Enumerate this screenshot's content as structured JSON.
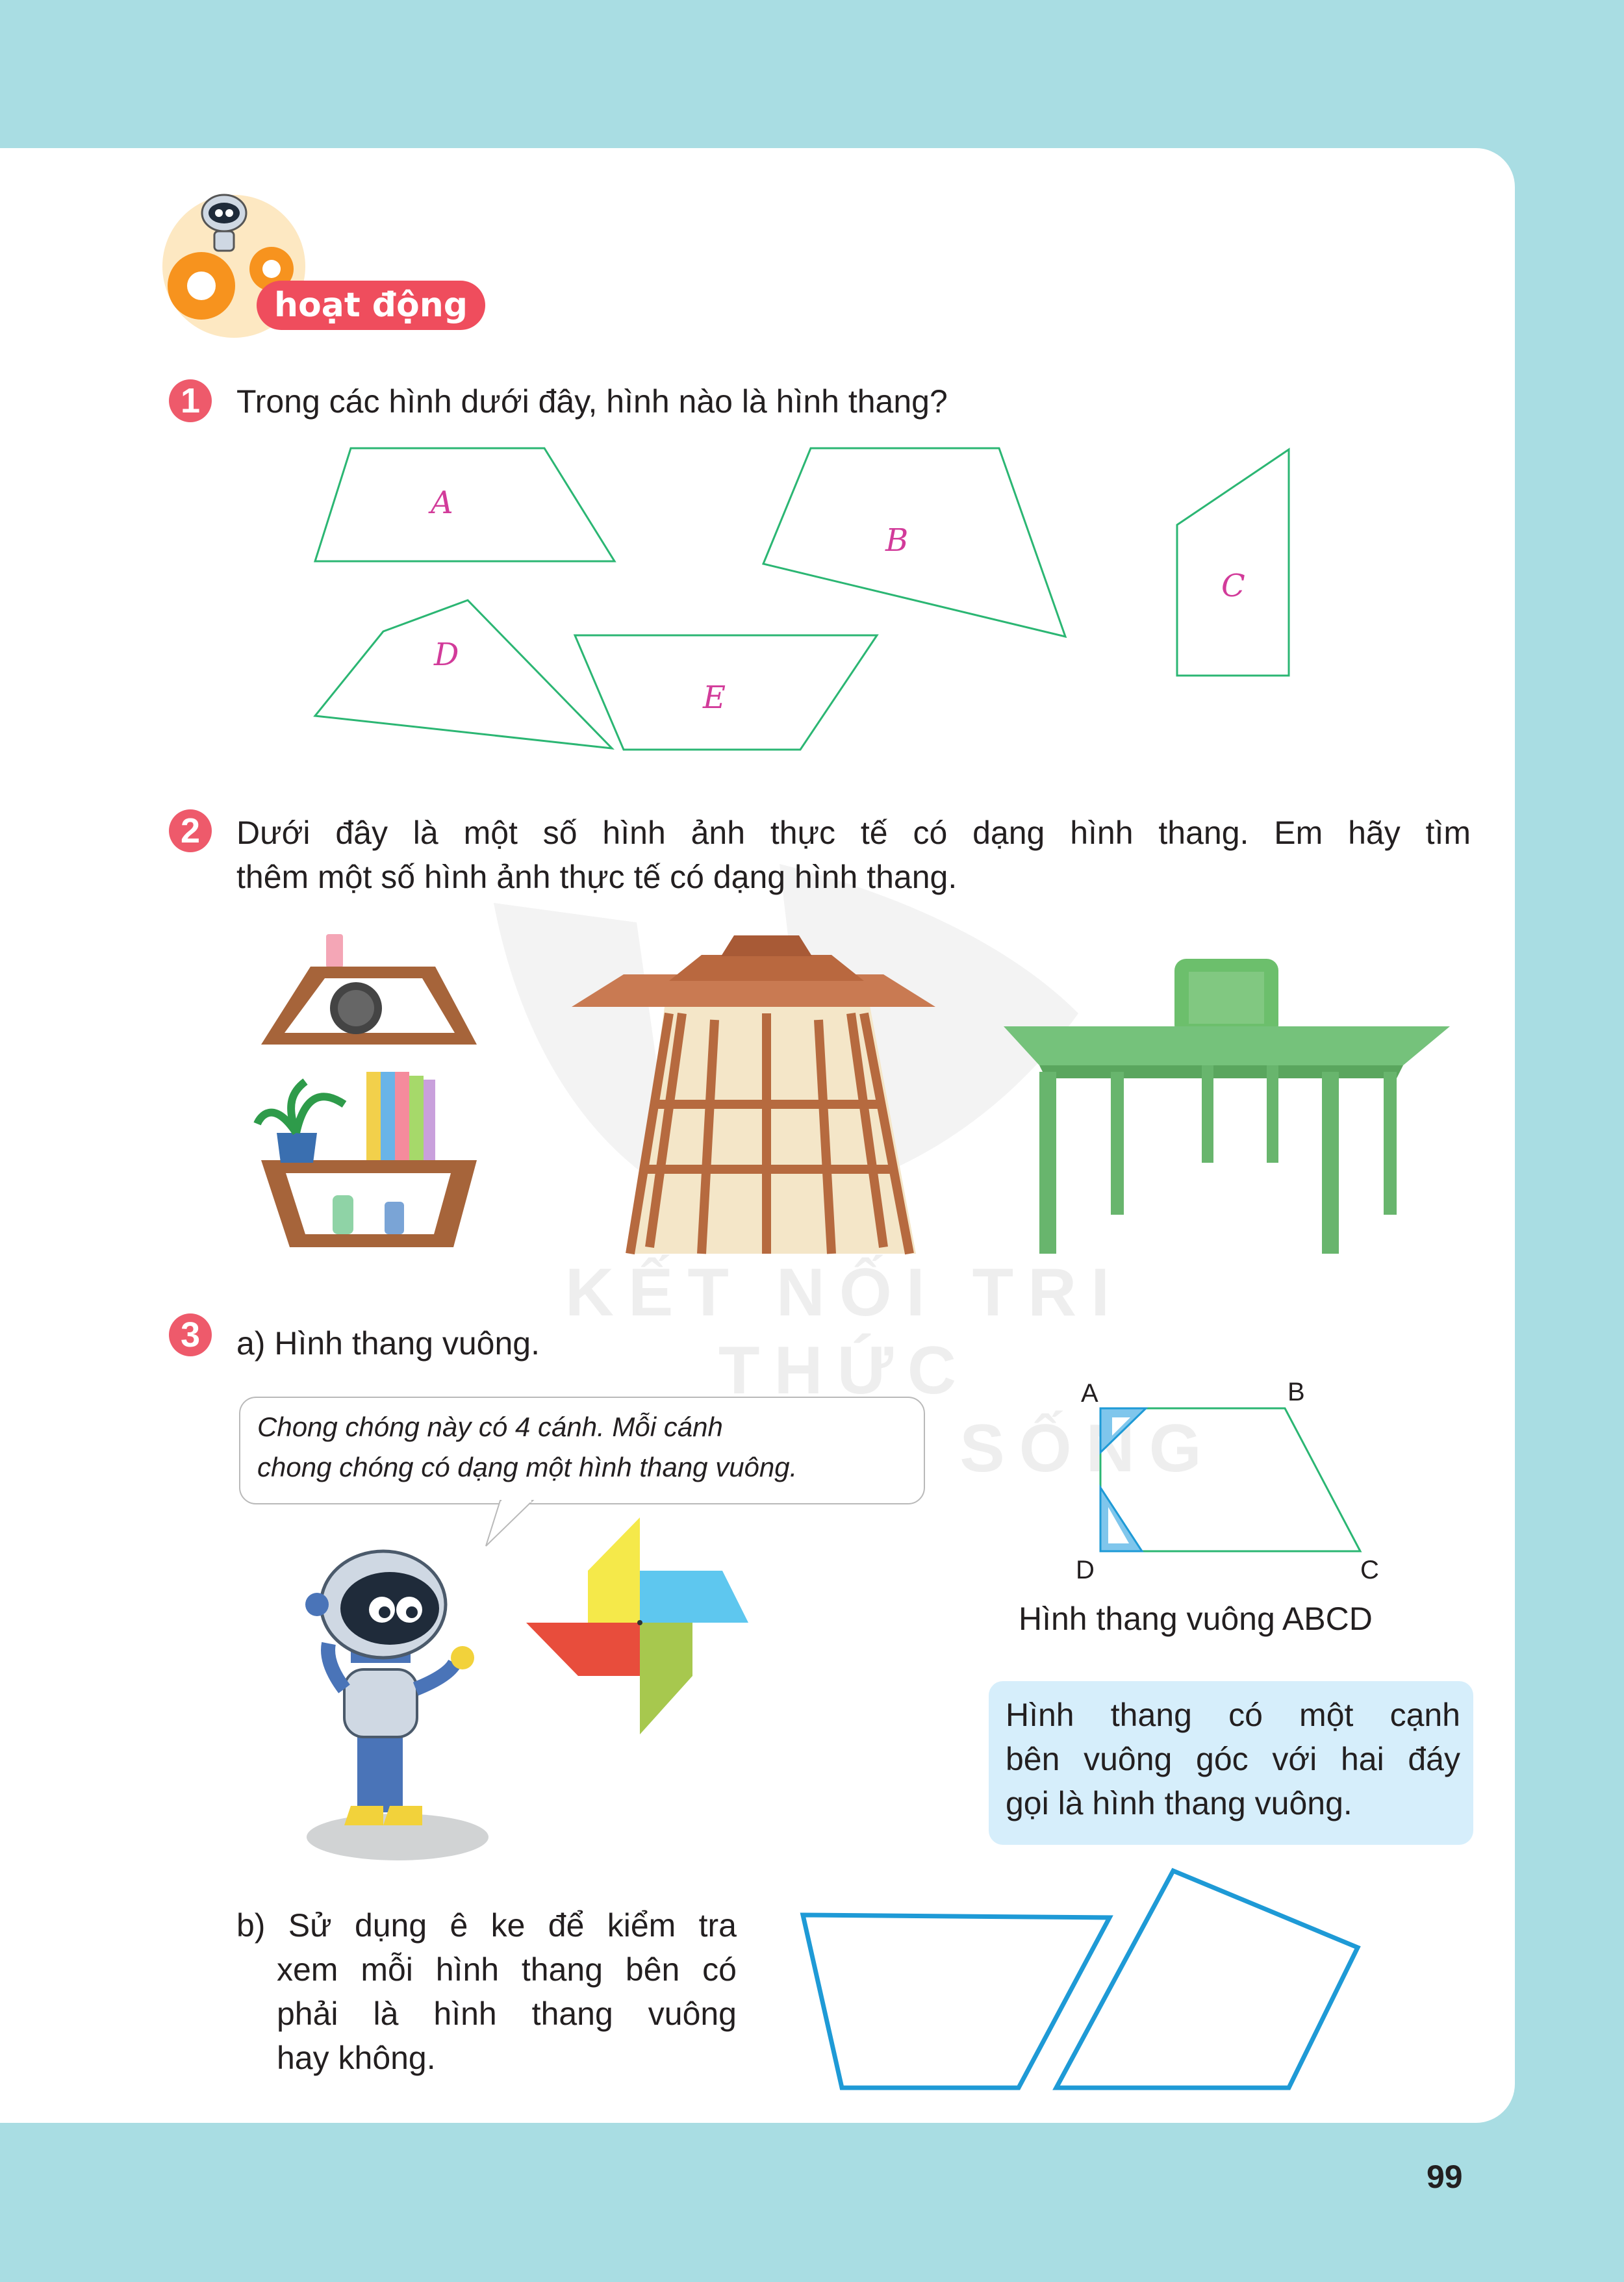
{
  "header": {
    "badge": "hoạt động"
  },
  "q1": {
    "number": "1",
    "text": "Trong các hình dưới đây, hình nào là hình thang?",
    "shapes": [
      "A",
      "B",
      "C",
      "D",
      "E"
    ]
  },
  "q2": {
    "number": "2",
    "line1": "Dưới đây là một số hình ảnh thực tế có dạng hình thang. Em hãy tìm",
    "line2": "thêm một số hình ảnh thực tế có dạng hình thang."
  },
  "watermark": {
    "line1": "KẾT NỐI TRI THỨC",
    "line2": "VỚI CUỘC SỐNG"
  },
  "q3": {
    "number": "3",
    "part_a": "a) Hình thang vuông.",
    "speech_line1": "Chong chóng này có 4 cánh. Mỗi cánh",
    "speech_line2": "chong chóng có dạng một hình thang vuông.",
    "vertices": {
      "a": "A",
      "b": "B",
      "c": "C",
      "d": "D"
    },
    "caption": "Hình thang vuông ABCD",
    "note_line1": "Hình thang có một cạnh",
    "note_line2": "bên vuông góc với hai đáy",
    "note_line3": "gọi là hình thang vuông.",
    "part_b_line1": "b) Sử dụng ê ke để kiểm tra",
    "part_b_line2": "xem mỗi hình thang bên có",
    "part_b_line3": "phải là hình thang vuông",
    "part_b_line4": "hay không."
  },
  "footer": {
    "page_number": "99"
  },
  "colors": {
    "background": "#a9dde3",
    "number_badge": "#ee5a6b",
    "shape_stroke": "#2bb673",
    "label": "#d23b9a",
    "trapezoid_blue": "#1e9ad6",
    "note_bg": "#d6eefb"
  }
}
